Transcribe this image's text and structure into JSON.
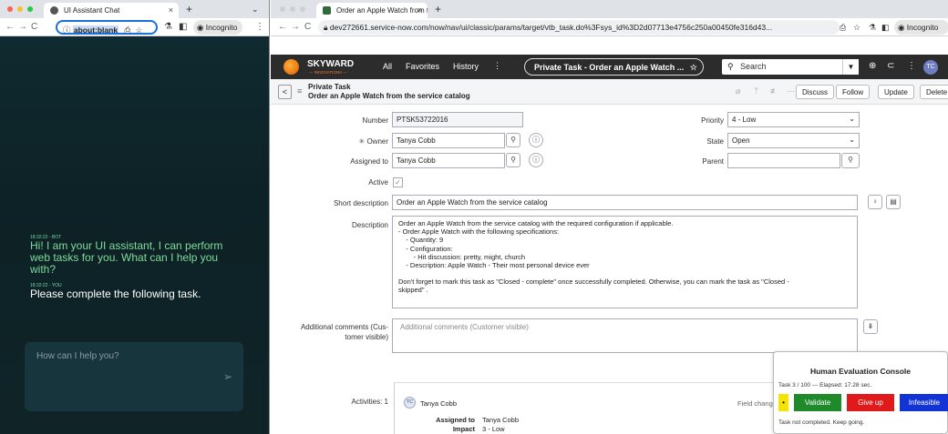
{
  "left_browser": {
    "tab_title": "UI Assistant Chat",
    "url": "about:blank",
    "incognito_label": "Incognito"
  },
  "chat": {
    "messages": [
      {
        "time": "18:32:22 - BOT",
        "text": "Hi! I am your UI assistant, I can perform web tasks for you. What can I help you with?",
        "role": "bot"
      },
      {
        "time": "18:32:22 - YOU",
        "text": "Please complete the following task.",
        "role": "user"
      }
    ],
    "input_placeholder": "How can I help you?"
  },
  "right_browser": {
    "tab_title": "Order an Apple Watch from th",
    "url": "dev272661.service-now.com/now/nav/ui/classic/params/target/vtb_task.do%3Fsys_id%3D2d07713e4756c250a00450fe316d43...",
    "incognito_label": "Incognito"
  },
  "sn_header": {
    "brand": "SKYWARD",
    "brand_sub": "— INNOVATIONS —",
    "all_label": "All",
    "favorites_label": "Favorites",
    "history_label": "History",
    "context_title": "Private Task - Order an Apple Watch ...",
    "search_placeholder": "Search",
    "avatar_initials": "TC"
  },
  "record_header": {
    "type": "Private Task",
    "subtitle": "Order an Apple Watch from the service catalog",
    "discuss_label": "Discuss",
    "follow_label": "Follow",
    "update_label": "Update",
    "delete_label": "Delete"
  },
  "form": {
    "number_label": "Number",
    "number_value": "PTSK53722016",
    "owner_label": "Owner",
    "owner_value": "Tanya Cobb",
    "assigned_label": "Assigned to",
    "assigned_value": "Tanya Cobb",
    "active_label": "Active",
    "priority_label": "Priority",
    "priority_value": "4 - Low",
    "state_label": "State",
    "state_value": "Open",
    "parent_label": "Parent",
    "parent_value": "",
    "short_desc_label": "Short description",
    "short_desc_value": "Order an Apple Watch from the service catalog",
    "description_label": "Description",
    "description_lines": [
      "Order an Apple Watch from the service catalog with the required configuration if applicable.",
      "- Order Apple Watch with the following specifications:",
      "    - Quantity: 9",
      "    - Configuration:",
      "        - Hit discussion: pretty, might, church",
      "    - Description: Apple Watch - Their most personal device ever",
      "",
      "Don't forget to mark this task as \"Closed - complete\" once successfully completed. Otherwise, you can mark the task as \"Closed -",
      "skipped\" ."
    ],
    "comments_label_1": "Additional comments (Cus-",
    "comments_label_2": "tomer visible)",
    "comments_placeholder": "Additional comments (Customer visible)",
    "activities_label": "Activities: 1"
  },
  "activity": {
    "initials": "TC",
    "name": "Tanya Cobb",
    "field_changes": "Field chang",
    "assigned_label": "Assigned to",
    "assigned_value": "Tanya Cobb",
    "impact_label": "Impact",
    "impact_value": "3 - Low"
  },
  "eval_console": {
    "title": "Human Evaluation Console",
    "status": "Task 3 / 100 --- Elapsed: 17.28 sec.",
    "star": "•",
    "validate_label": "Validate",
    "giveup_label": "Give up",
    "infeasible_label": "Infeasible",
    "footer": "Task not completed. Keep going.",
    "colors": {
      "validate": "#1f8a2a",
      "giveup": "#e01a1a",
      "infeasible": "#1233d6",
      "star": "#f5e400"
    }
  }
}
